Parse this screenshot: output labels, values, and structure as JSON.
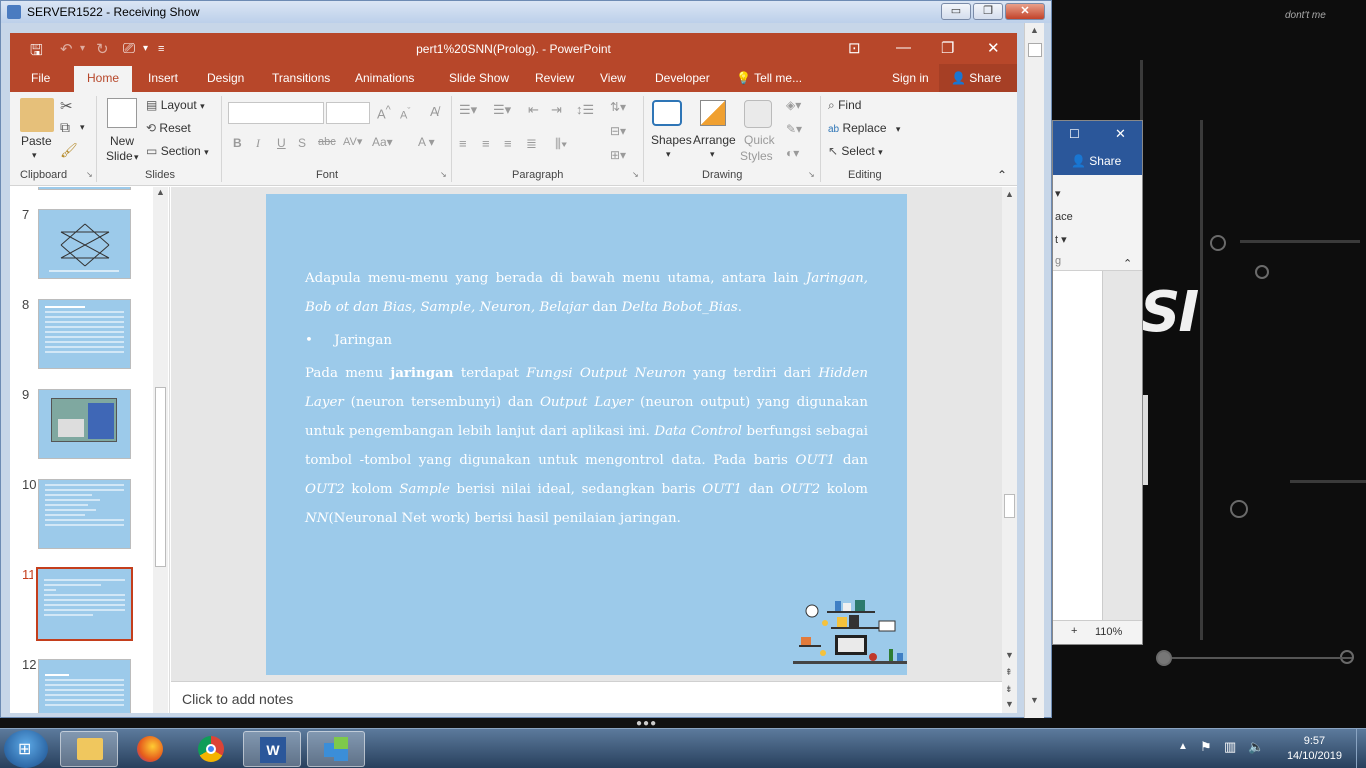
{
  "desktop": {
    "logo_text": "SI",
    "corner_text": "dont't me"
  },
  "remote_window": {
    "title": "SERVER1522 - Receiving Show",
    "minimize": "▭",
    "maximize": "❐",
    "close": "✕"
  },
  "bg_word": {
    "share": "Share",
    "frag1": "ace",
    "frag2": "t ▾",
    "frag3": "g",
    "zoom_plus": "+",
    "zoom": "110%"
  },
  "powerpoint": {
    "title": "pert1%20SNN(Prolog). - PowerPoint",
    "tabs": [
      "File",
      "Home",
      "Insert",
      "Design",
      "Transitions",
      "Animations",
      "Slide Show",
      "Review",
      "View",
      "Developer"
    ],
    "tell_me": "Tell me...",
    "sign_in": "Sign in",
    "share": "Share",
    "ribbon": {
      "paste": "Paste",
      "clipboard": "Clipboard",
      "new_slide_1": "New",
      "new_slide_2": "Slide",
      "layout": "Layout",
      "reset": "Reset",
      "section": "Section",
      "slides": "Slides",
      "font": "Font",
      "paragraph": "Paragraph",
      "shapes": "Shapes",
      "arrange": "Arrange",
      "quick_styles_1": "Quick",
      "quick_styles_2": "Styles",
      "drawing": "Drawing",
      "find": "Find",
      "replace": "Replace",
      "select": "Select",
      "editing": "Editing"
    },
    "thumbnails": [
      {
        "num": "7"
      },
      {
        "num": "8"
      },
      {
        "num": "9"
      },
      {
        "num": "10"
      },
      {
        "num": "11"
      },
      {
        "num": "12"
      }
    ],
    "slide": {
      "p1_a": "Adapula menu-menu yang berada di bawah menu utama, antara lain ",
      "p1_b": "Jaringan, Bob ot dan Bias, Sample, Neuron, Belajar",
      "p1_c": " dan ",
      "p1_d": "Delta Bobot_Bias",
      "p1_e": ".",
      "bullet": "Jaringan",
      "p2_a": "Pada menu ",
      "p2_b": "jaringan",
      "p2_c": " terdapat ",
      "p2_d": "Fungsi Output Neuron",
      "p2_e": " yang terdiri dari ",
      "p2_f": "Hidden Layer",
      "p2_g": " (neuron tersembunyi) dan ",
      "p2_h": "Output Layer",
      "p2_i": " (neuron output) yang digunakan untuk pengembangan lebih lanjut dari aplikasi ini. ",
      "p2_j": "Data Control",
      "p2_k": " berfungsi sebagai tombol -tombol yang digunakan untuk mengontrol data. Pada baris ",
      "p2_l": "OUT1",
      "p2_m": " dan ",
      "p2_n": "OUT2",
      "p2_o": " kolom ",
      "p2_p": "Sample",
      "p2_q": " berisi nilai ideal, sedangkan baris ",
      "p2_r": "OUT1",
      "p2_s": " dan ",
      "p2_t": "OUT2",
      "p2_u": " kolom ",
      "p2_v": "NN",
      "p2_w": "(Neuronal Net work) berisi hasil penilaian jaringan."
    },
    "notes_placeholder": "Click to add notes"
  },
  "taskbar": {
    "time": "9:57",
    "date": "14/10/2019"
  },
  "colors": {
    "pp_accent": "#b7472a",
    "slide_bg": "#9ccaea",
    "word_accent": "#2b579a"
  }
}
